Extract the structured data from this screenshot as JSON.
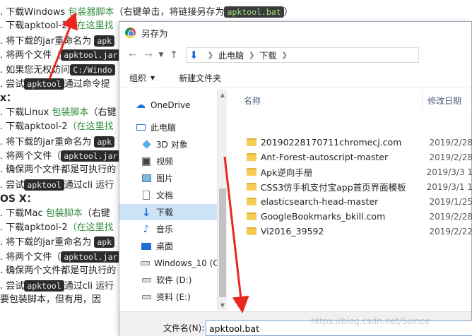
{
  "background": {
    "lines": [
      {
        "pre": ". 下载Windows ",
        "link": "包装器脚本",
        "mid": "（右键单击，将链接另存为",
        "code": "apktool.bat",
        "post": "）"
      },
      {
        "pre": ". 下载apktool-2",
        "link": "（在这里找",
        "mid": "",
        "code": "",
        "post": ""
      },
      {
        "pre": ". 将下载的jar重命名为 ",
        "link": "",
        "mid": "",
        "code": "apk",
        "post": ""
      },
      {
        "pre": ". 将两个文件（",
        "link": "",
        "mid": "",
        "code": "apktool.jar",
        "post": ""
      },
      {
        "pre": ". 如果您无权访问",
        "link": "",
        "mid": "",
        "code": "C:/Windo",
        "post": ""
      },
      {
        "pre": ". 尝试",
        "link": "",
        "mid": "",
        "code": "apktool",
        "post": "通过命令提"
      },
      {
        "pre": "x：",
        "link": "",
        "mid": "",
        "code": "",
        "post": ""
      },
      {
        "pre": ". 下载Linux ",
        "link": "包装脚本",
        "mid": "（右键",
        "code": "",
        "post": ""
      },
      {
        "pre": ". 下载apktool-2",
        "link": "（在这里找",
        "mid": "",
        "code": "",
        "post": ""
      },
      {
        "pre": ". 将下载的jar重命名为 ",
        "link": "",
        "mid": "",
        "code": "apk",
        "post": ""
      },
      {
        "pre": ". 将两个文件（",
        "link": "",
        "mid": "",
        "code": "apktool.jar",
        "post": ""
      },
      {
        "pre": ". 确保两个文件都是可执行的",
        "link": "",
        "mid": "",
        "code": "",
        "post": ""
      },
      {
        "pre": ". 尝试",
        "link": "",
        "mid": "",
        "code": "apktool",
        "post": "通过cli 运行"
      },
      {
        "pre": "OS X：",
        "link": "",
        "mid": "",
        "code": "",
        "post": ""
      },
      {
        "pre": ". 下载Mac ",
        "link": "包装脚本",
        "mid": "（右键",
        "code": "",
        "post": ""
      },
      {
        "pre": ". 下载apktool-2",
        "link": "（在这里找",
        "mid": "",
        "code": "",
        "post": ""
      },
      {
        "pre": ". 将下载的jar重命名为 ",
        "link": "",
        "mid": "",
        "code": "apk",
        "post": ""
      },
      {
        "pre": ". 将两个文件（",
        "link": "",
        "mid": "",
        "code": "apktool.jar",
        "post": ""
      },
      {
        "pre": ". 确保两个文件都是可执行的",
        "link": "",
        "mid": "",
        "code": "",
        "post": ""
      },
      {
        "pre": ". 尝试",
        "link": "",
        "mid": "",
        "code": "apktool",
        "post": "通过cli 运行"
      },
      {
        "pre": "要包装脚本，但有用，因",
        "link": "",
        "mid": "",
        "code": "",
        "post": ""
      }
    ]
  },
  "dialog": {
    "title": "另存为",
    "address": {
      "root": "此电脑",
      "current": "下载"
    },
    "toolbar": {
      "organize": "组织",
      "new_folder": "新建文件夹"
    },
    "nav_items": [
      {
        "label": "OneDrive",
        "icon": "cloud-icon"
      },
      {
        "label": "此电脑",
        "icon": "computer-icon"
      },
      {
        "label": "3D 对象",
        "icon": "3d-objects-icon"
      },
      {
        "label": "视频",
        "icon": "video-icon"
      },
      {
        "label": "图片",
        "icon": "pictures-icon"
      },
      {
        "label": "文档",
        "icon": "documents-icon"
      },
      {
        "label": "下载",
        "icon": "download-icon",
        "selected": true
      },
      {
        "label": "音乐",
        "icon": "music-icon"
      },
      {
        "label": "桌面",
        "icon": "desktop-icon"
      },
      {
        "label": "Windows_10 (C",
        "icon": "drive-icon"
      },
      {
        "label": "软件 (D:)",
        "icon": "drive-icon"
      },
      {
        "label": "资料 (E:)",
        "icon": "drive-icon"
      }
    ],
    "columns": {
      "name": "名称",
      "date": "修改日期"
    },
    "files": [
      {
        "name": "20190228170711chromecj.com",
        "date": "2019/2/28"
      },
      {
        "name": "Ant-Forest-autoscript-master",
        "date": "2019/2/28"
      },
      {
        "name": "Apk逆向手册",
        "date": "2019/3/3 1"
      },
      {
        "name": "CSS3仿手机支付宝app首页界面模板",
        "date": "2019/3/1 1"
      },
      {
        "name": "elasticsearch-head-master",
        "date": "2019/1/25"
      },
      {
        "name": "GoogleBookmarks_bkill.com",
        "date": "2019/2/28"
      },
      {
        "name": "Vi2016_39592",
        "date": "2019/2/22"
      }
    ],
    "filename": {
      "label": "文件名(N):",
      "value": "apktool.bat"
    }
  },
  "watermark": "https://blog.csdn.net/Soince",
  "colors": {
    "accent": "#1e6fd6",
    "selection": "#cce3f8",
    "folder": "#f5cd56",
    "annotation": "#e8281e"
  }
}
